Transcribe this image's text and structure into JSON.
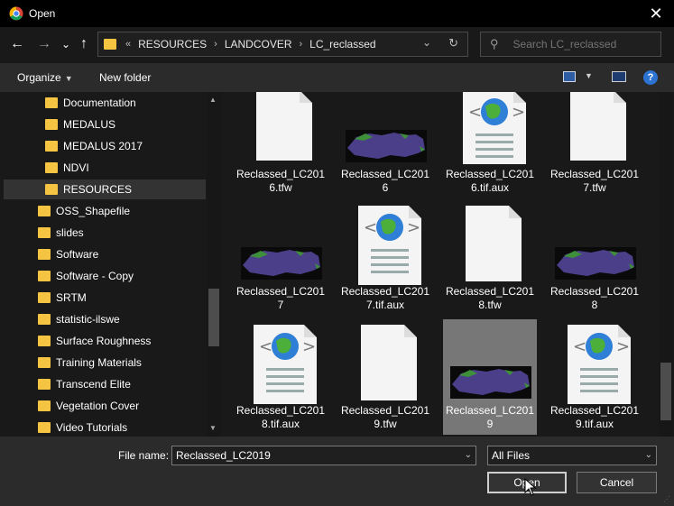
{
  "window": {
    "title": "Open",
    "close_glyph": "✕"
  },
  "nav": {
    "back_glyph": "←",
    "forward_glyph": "→",
    "recent_glyph": "⌄",
    "up_glyph": "↑",
    "breadcrumb_prefix": "«",
    "breadcrumb": [
      "RESOURCES",
      "LANDCOVER",
      "LC_reclassed"
    ],
    "breadcrumb_sep": "›",
    "search_placeholder": "Search LC_reclassed"
  },
  "toolbar": {
    "organize_label": "Organize",
    "new_folder_label": "New folder"
  },
  "navpane": {
    "items": [
      {
        "label": "Documentation",
        "indent": 2,
        "selected": false
      },
      {
        "label": "MEDALUS",
        "indent": 2,
        "selected": false
      },
      {
        "label": "MEDALUS 2017",
        "indent": 2,
        "selected": false
      },
      {
        "label": "NDVI",
        "indent": 2,
        "selected": false
      },
      {
        "label": "RESOURCES",
        "indent": 2,
        "selected": true
      },
      {
        "label": "OSS_Shapefile",
        "indent": 1,
        "selected": false
      },
      {
        "label": "slides",
        "indent": 1,
        "selected": false
      },
      {
        "label": "Software",
        "indent": 1,
        "selected": false
      },
      {
        "label": "Software - Copy",
        "indent": 1,
        "selected": false
      },
      {
        "label": "SRTM",
        "indent": 1,
        "selected": false
      },
      {
        "label": "statistic-ilswe",
        "indent": 1,
        "selected": false
      },
      {
        "label": "Surface Roughness",
        "indent": 1,
        "selected": false
      },
      {
        "label": "Training Materials",
        "indent": 1,
        "selected": false
      },
      {
        "label": "Transcend Elite",
        "indent": 1,
        "selected": false
      },
      {
        "label": "Vegetation Cover",
        "indent": 1,
        "selected": false
      },
      {
        "label": "Video Tutorials",
        "indent": 1,
        "selected": false
      }
    ]
  },
  "files": [
    {
      "line1": "Reclassed_LC201",
      "line2": "6.tfw",
      "kind": "doc",
      "selected": false
    },
    {
      "line1": "Reclassed_LC201",
      "line2": "6",
      "kind": "map",
      "selected": false
    },
    {
      "line1": "Reclassed_LC201",
      "line2": "6.tif.aux",
      "kind": "aux",
      "selected": false
    },
    {
      "line1": "Reclassed_LC201",
      "line2": "7.tfw",
      "kind": "doc",
      "selected": false
    },
    {
      "line1": "Reclassed_LC201",
      "line2": "7",
      "kind": "map",
      "selected": false
    },
    {
      "line1": "Reclassed_LC201",
      "line2": "7.tif.aux",
      "kind": "aux",
      "selected": false
    },
    {
      "line1": "Reclassed_LC201",
      "line2": "8.tfw",
      "kind": "doc",
      "selected": false
    },
    {
      "line1": "Reclassed_LC201",
      "line2": "8",
      "kind": "map",
      "selected": false
    },
    {
      "line1": "Reclassed_LC201",
      "line2": "8.tif.aux",
      "kind": "aux",
      "selected": false
    },
    {
      "line1": "Reclassed_LC201",
      "line2": "9.tfw",
      "kind": "doc",
      "selected": false
    },
    {
      "line1": "Reclassed_LC201",
      "line2": "9",
      "kind": "map",
      "selected": true
    },
    {
      "line1": "Reclassed_LC201",
      "line2": "9.tif.aux",
      "kind": "aux",
      "selected": false
    }
  ],
  "bottom": {
    "file_name_label": "File name:",
    "file_name_value": "Reclassed_LC2019",
    "filter_value": "All Files",
    "open_label": "Open",
    "cancel_label": "Cancel"
  },
  "colors": {
    "folder": "#f5c542",
    "map_land": "#4b3f8a",
    "map_green": "#3e8f3a",
    "selected_tile": "#777777"
  }
}
